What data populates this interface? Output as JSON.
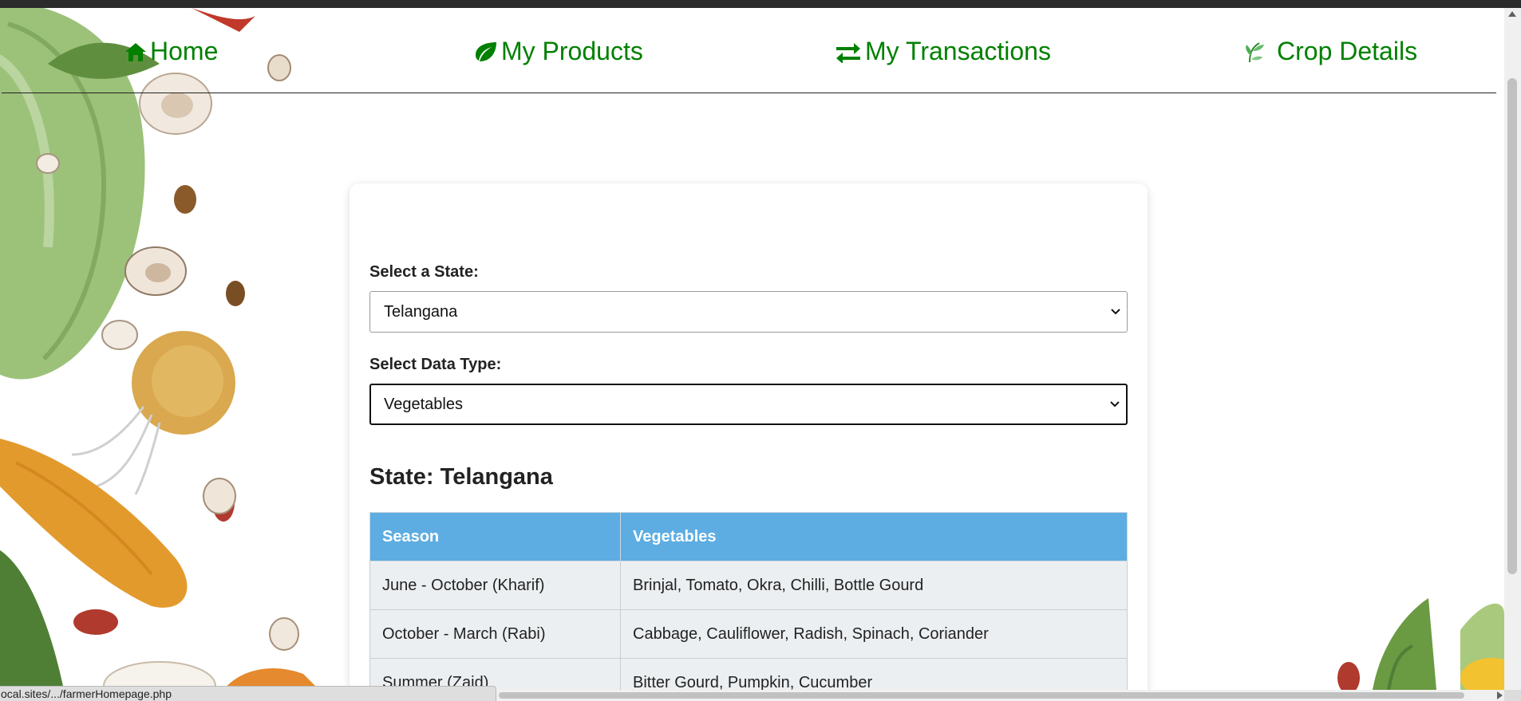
{
  "nav": {
    "home": "Home",
    "products": "My Products",
    "transactions": "My Transactions",
    "crop_details": "Crop Details"
  },
  "form": {
    "state_label": "Select a State:",
    "state_value": "Telangana",
    "datatype_label": "Select Data Type:",
    "datatype_value": "Vegetables"
  },
  "result": {
    "heading": "State: Telangana",
    "columns": [
      "Season",
      "Vegetables"
    ],
    "rows": [
      [
        "June - October (Kharif)",
        "Brinjal, Tomato, Okra, Chilli, Bottle Gourd"
      ],
      [
        "October - March (Rabi)",
        "Cabbage, Cauliflower, Radish, Spinach, Coriander"
      ],
      [
        "Summer (Zaid)",
        "Bitter Gourd, Pumpkin, Cucumber"
      ]
    ]
  },
  "status_bar": {
    "url": "ocal.sites/.../farmerHomepage.php"
  },
  "colors": {
    "nav_text": "#008000",
    "table_header_bg": "#5dade2",
    "table_row_bg": "#eceff1"
  },
  "icons": {
    "home": "home-icon",
    "products": "leaf-icon",
    "transactions": "exchange-icon",
    "crop_details": "sprout-icon"
  }
}
